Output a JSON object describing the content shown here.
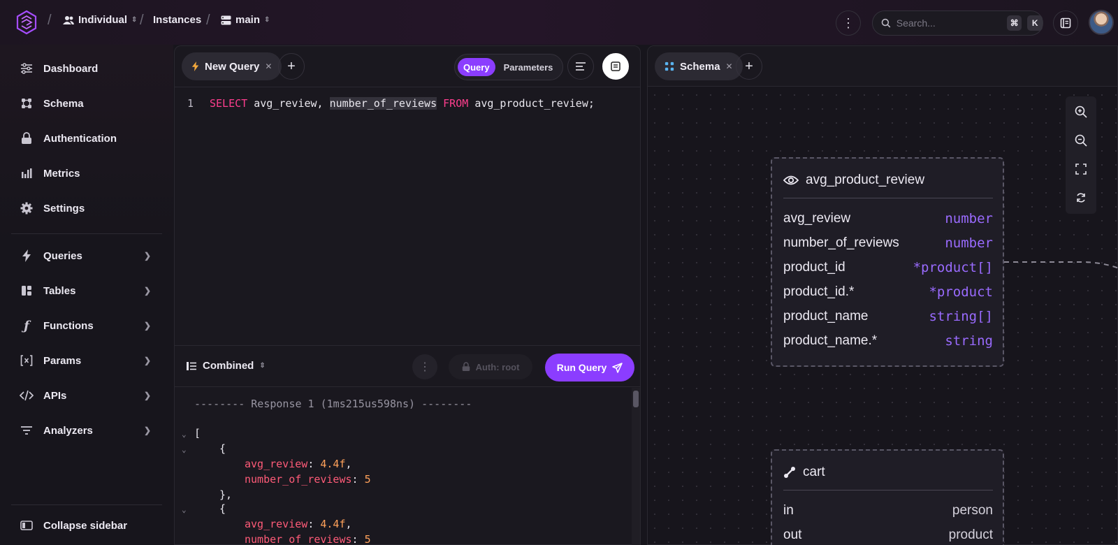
{
  "breadcrumb": {
    "workspace": "Individual",
    "instances": "Instances",
    "branch": "main"
  },
  "search": {
    "placeholder": "Search...",
    "shortcut_mod": "⌘",
    "shortcut_key": "K"
  },
  "sidebar": {
    "items": [
      {
        "label": "Dashboard",
        "icon": "dashboard-icon"
      },
      {
        "label": "Schema",
        "icon": "schema-icon"
      },
      {
        "label": "Authentication",
        "icon": "lock-icon"
      },
      {
        "label": "Metrics",
        "icon": "bar-chart-icon"
      },
      {
        "label": "Settings",
        "icon": "gear-icon"
      },
      {
        "label": "Queries",
        "icon": "lightning-icon"
      },
      {
        "label": "Tables",
        "icon": "tables-icon"
      },
      {
        "label": "Functions",
        "icon": "function-icon"
      },
      {
        "label": "Params",
        "icon": "params-icon"
      },
      {
        "label": "APIs",
        "icon": "code-icon"
      },
      {
        "label": "Analyzers",
        "icon": "filter-icon"
      }
    ],
    "collapse_label": "Collapse sidebar"
  },
  "query_panel": {
    "tab_label": "New Query",
    "mode_query": "Query",
    "mode_parameters": "Parameters",
    "line_number": "1",
    "code": {
      "select": "SELECT",
      "field1": "avg_review, ",
      "field2": "number_of_reviews",
      "from": "FROM",
      "table": "avg_product_review;"
    },
    "results_label": "Combined",
    "auth_label": "Auth: root",
    "run_label": "Run Query"
  },
  "output": {
    "header": "-------- Response 1 (1ms215us598ns) --------",
    "open_bracket": "[",
    "open_brace": "{",
    "close_brace": "},",
    "key1": "avg_review",
    "val1": "4.4f",
    "key2": "number_of_reviews",
    "val2": "5"
  },
  "schema_panel": {
    "tab_label": "Schema",
    "nodes": [
      {
        "name": "avg_product_review",
        "icon": "eye-icon",
        "fields": [
          {
            "name": "avg_review",
            "type": "number"
          },
          {
            "name": "number_of_reviews",
            "type": "number"
          },
          {
            "name": "product_id",
            "type": "*product[]"
          },
          {
            "name": "product_id.*",
            "type": "*product"
          },
          {
            "name": "product_name",
            "type": "string[]"
          },
          {
            "name": "product_name.*",
            "type": "string"
          }
        ]
      },
      {
        "name": "cart",
        "icon": "relation-icon",
        "fields": [
          {
            "name": "in",
            "type": "person"
          },
          {
            "name": "out",
            "type": "product"
          }
        ]
      }
    ]
  },
  "colors": {
    "accent": "#8b3dff",
    "keyword": "#ff3e8e",
    "property": "#ff5b78",
    "number": "#ffa15a",
    "type": "#9a6bff"
  }
}
